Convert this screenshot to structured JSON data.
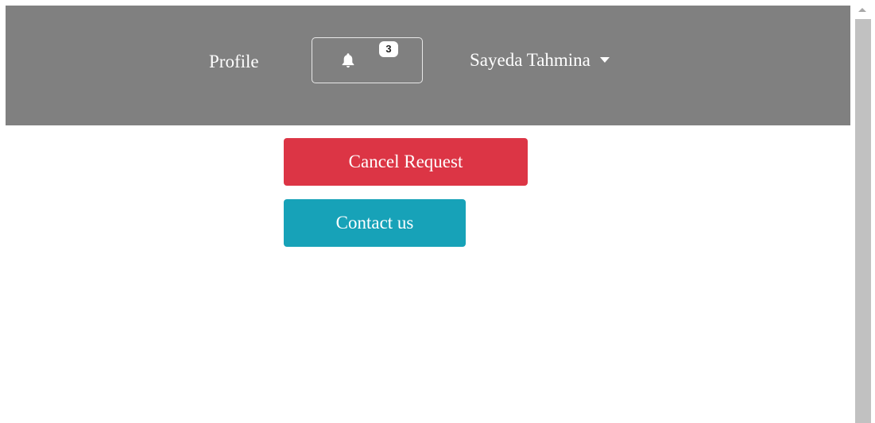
{
  "navbar": {
    "profile_label": "Profile",
    "notifications": {
      "icon": "bell-icon",
      "count": "3"
    },
    "user_name": "Sayeda Tahmina",
    "user_menu_icon": "caret-down-icon"
  },
  "actions": {
    "cancel_request_label": "Cancel Request",
    "contact_us_label": "Contact us"
  },
  "colors": {
    "navbar_bg": "#808080",
    "danger": "#dc3545",
    "info": "#17a2b8",
    "text_light": "#ffffff"
  }
}
